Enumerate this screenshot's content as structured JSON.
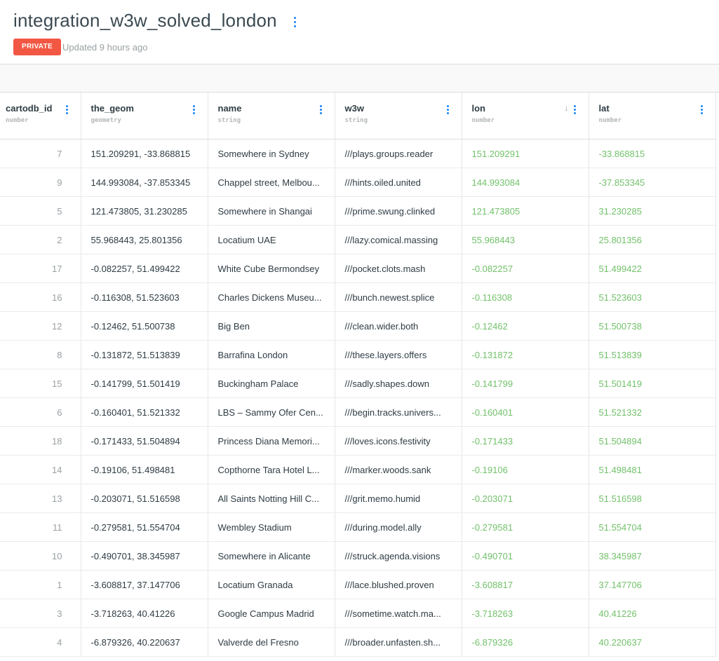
{
  "dataset": {
    "title": "integration_w3w_solved_london",
    "privacy": "PRIVATE",
    "updated": "Updated 9 hours ago",
    "accent_color": "#1785fb",
    "privacy_color": "#f15743",
    "number_color": "#72c16a"
  },
  "columns": [
    {
      "name": "cartodb_id",
      "type": "number"
    },
    {
      "name": "the_geom",
      "type": "geometry"
    },
    {
      "name": "name",
      "type": "string"
    },
    {
      "name": "w3w",
      "type": "string"
    },
    {
      "name": "lon",
      "type": "number",
      "sort": "↓"
    },
    {
      "name": "lat",
      "type": "number"
    }
  ],
  "rows": [
    [
      "7",
      "151.209291, -33.868815",
      "Somewhere in Sydney",
      "///plays.groups.reader",
      "151.209291",
      "-33.868815"
    ],
    [
      "9",
      "144.993084, -37.853345",
      "Chappel street, Melbou...",
      "///hints.oiled.united",
      "144.993084",
      "-37.853345"
    ],
    [
      "5",
      "121.473805, 31.230285",
      "Somewhere in Shangai",
      "///prime.swung.clinked",
      "121.473805",
      "31.230285"
    ],
    [
      "2",
      "55.968443, 25.801356",
      "Locatium UAE",
      "///lazy.comical.massing",
      "55.968443",
      "25.801356"
    ],
    [
      "17",
      "-0.082257, 51.499422",
      "White Cube Bermondsey",
      "///pocket.clots.mash",
      "-0.082257",
      "51.499422"
    ],
    [
      "16",
      "-0.116308, 51.523603",
      "Charles Dickens Museu...",
      "///bunch.newest.splice",
      "-0.116308",
      "51.523603"
    ],
    [
      "12",
      "-0.12462, 51.500738",
      "Big Ben",
      "///clean.wider.both",
      "-0.12462",
      "51.500738"
    ],
    [
      "8",
      "-0.131872, 51.513839",
      "Barrafina London",
      "///these.layers.offers",
      "-0.131872",
      "51.513839"
    ],
    [
      "15",
      "-0.141799, 51.501419",
      "Buckingham Palace",
      "///sadly.shapes.down",
      "-0.141799",
      "51.501419"
    ],
    [
      "6",
      "-0.160401, 51.521332",
      "LBS – Sammy Ofer Cen...",
      "///begin.tracks.univers...",
      "-0.160401",
      "51.521332"
    ],
    [
      "18",
      "-0.171433, 51.504894",
      "Princess Diana Memori...",
      "///loves.icons.festivity",
      "-0.171433",
      "51.504894"
    ],
    [
      "14",
      "-0.19106, 51.498481",
      "Copthorne Tara Hotel L...",
      "///marker.woods.sank",
      "-0.19106",
      "51.498481"
    ],
    [
      "13",
      "-0.203071, 51.516598",
      "All Saints Notting Hill C...",
      "///grit.memo.humid",
      "-0.203071",
      "51.516598"
    ],
    [
      "11",
      "-0.279581, 51.554704",
      "Wembley Stadium",
      "///during.model.ally",
      "-0.279581",
      "51.554704"
    ],
    [
      "10",
      "-0.490701, 38.345987",
      "Somewhere in Alicante",
      "///struck.agenda.visions",
      "-0.490701",
      "38.345987"
    ],
    [
      "1",
      "-3.608817, 37.147706",
      "Locatium Granada",
      "///lace.blushed.proven",
      "-3.608817",
      "37.147706"
    ],
    [
      "3",
      "-3.718263, 40.41226",
      "Google Campus Madrid",
      "///sometime.watch.ma...",
      "-3.718263",
      "40.41226"
    ],
    [
      "4",
      "-6.879326, 40.220637",
      "Valverde del Fresno",
      "///broader.unfasten.sh...",
      "-6.879326",
      "40.220637"
    ]
  ]
}
